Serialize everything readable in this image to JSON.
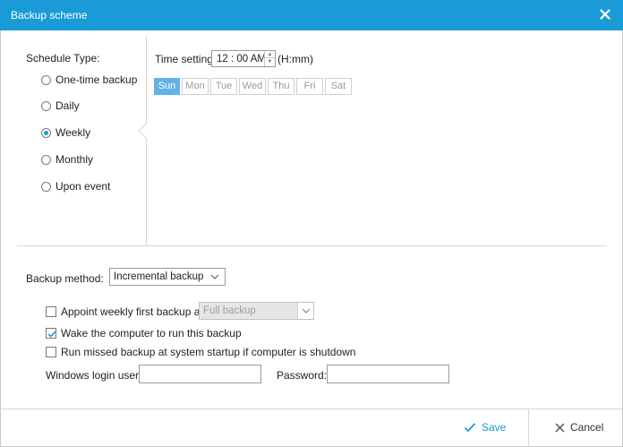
{
  "window": {
    "title": "Backup scheme"
  },
  "schedule": {
    "label": "Schedule Type:",
    "options": [
      {
        "label": "One-time backup",
        "checked": false
      },
      {
        "label": "Daily",
        "checked": false
      },
      {
        "label": "Weekly",
        "checked": true
      },
      {
        "label": "Monthly",
        "checked": false
      },
      {
        "label": "Upon event",
        "checked": false
      }
    ]
  },
  "time": {
    "label": "Time setting",
    "value": "12 : 00 AM",
    "unit": "(H:mm)"
  },
  "days": [
    {
      "label": "Sun",
      "selected": true
    },
    {
      "label": "Mon",
      "selected": false
    },
    {
      "label": "Tue",
      "selected": false
    },
    {
      "label": "Wed",
      "selected": false
    },
    {
      "label": "Thu",
      "selected": false
    },
    {
      "label": "Fri",
      "selected": false
    },
    {
      "label": "Sat",
      "selected": false
    }
  ],
  "method": {
    "label": "Backup method:",
    "value": "Incremental backup"
  },
  "options": {
    "appoint_label": "Appoint weekly first backup as",
    "appoint_checked": false,
    "appoint_value": "Full backup",
    "wake_label": "Wake the computer to run this backup",
    "wake_checked": true,
    "missed_label": "Run missed backup at system startup if computer is shutdown",
    "missed_checked": false
  },
  "login": {
    "user_label": "Windows login user:",
    "user_value": "",
    "password_label": "Password:",
    "password_value": ""
  },
  "footer": {
    "save_label": "Save",
    "cancel_label": "Cancel"
  },
  "colors": {
    "accent": "#1a9bd7",
    "day_selected": "#62b3e4"
  },
  "icons": {
    "close": "close-icon",
    "save": "checkmark-icon",
    "cancel": "x-icon",
    "dropdown": "chevron-down-icon"
  }
}
